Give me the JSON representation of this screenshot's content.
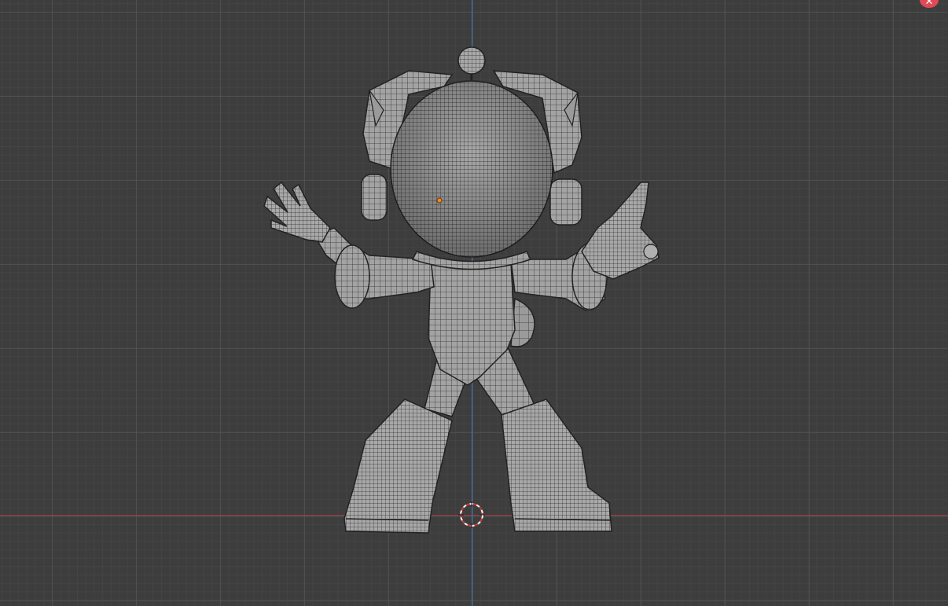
{
  "viewport": {
    "background_color": "#3d3d3d",
    "grid_major_color": "#5a5a5a",
    "grid_minor_color": "#484848",
    "x_axis_color": "#a83e48",
    "y_axis_color": "#3f73b6"
  },
  "model": {
    "shading": "wireframe-over-solid",
    "surface_color": "#9c9c9c",
    "wire_color": "#2a2a2a"
  },
  "gizmo": {
    "close_glyph": "✕",
    "close_color": "#e04a57"
  },
  "icons": [
    "close-icon",
    "3d-cursor-icon",
    "origin-dot-icon"
  ]
}
